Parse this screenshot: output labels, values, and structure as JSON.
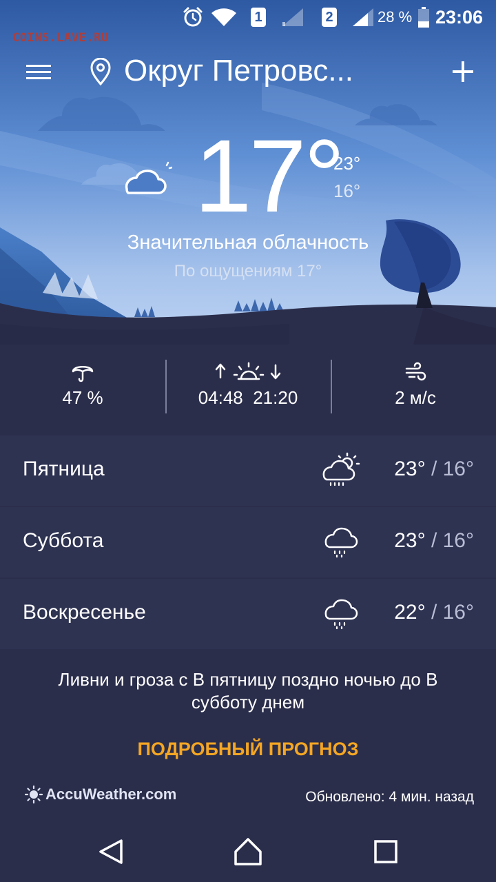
{
  "status_bar": {
    "alarm_icon": "alarm-clock-icon",
    "wifi_icon": "wifi-icon",
    "sim1_label": "1",
    "sim2_label": "2",
    "battery_text": "28 %",
    "time": "23:06"
  },
  "watermark": "COINS.LAVE.RU",
  "header": {
    "menu_icon": "hamburger-menu-icon",
    "location_icon": "location-pin-icon",
    "location": "Округ Петровс...",
    "add_icon": "plus-icon"
  },
  "current": {
    "icon": "partly-cloudy-night-icon",
    "temperature": "17°",
    "high": "23°",
    "low": "16°",
    "condition": "Значительная облачность",
    "feels_like": "По ощущениям 17°"
  },
  "stats": {
    "precip_icon": "umbrella-icon",
    "precip": "47 %",
    "sun_icon": "sunrise-sunset-icon",
    "sunrise": "04:48",
    "sunset": "21:20",
    "wind_icon": "wind-icon",
    "wind": "2 м/с"
  },
  "forecast": [
    {
      "day": "Пятница",
      "icon": "partly-sunny-showers-icon",
      "high": "23°",
      "low": "16°"
    },
    {
      "day": "Суббота",
      "icon": "cloud-showers-icon",
      "high": "23°",
      "low": "16°"
    },
    {
      "day": "Воскресенье",
      "icon": "cloud-showers-icon",
      "high": "22°",
      "low": "16°"
    }
  ],
  "summary": "Ливни и гроза с В пятницу поздно ночью до В субботу днем",
  "details_link": "ПОДРОБНЫЙ ПРОГНОЗ",
  "footer": {
    "brand_icon": "accuweather-sun-icon",
    "brand": "AccuWeather.com",
    "updated": "Обновлено: 4 мин. назад"
  },
  "nav": {
    "back_icon": "back-triangle-icon",
    "home_icon": "home-icon",
    "recents_icon": "recents-square-icon"
  },
  "colors": {
    "accent": "#f5a623",
    "background": "#2b2e4b",
    "row_background": "#2f3352",
    "sky_top": "#2f5ea8",
    "sky_bottom": "#a9c5ee"
  }
}
